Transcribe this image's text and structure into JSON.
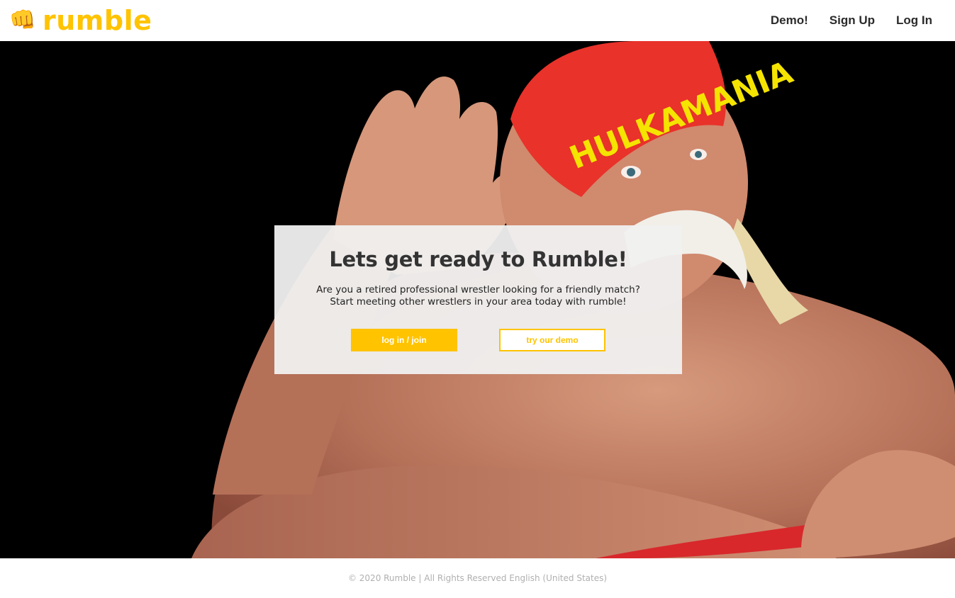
{
  "header": {
    "logo_icon": "fist-icon",
    "logo_glyph": "👊",
    "brand": "rumble",
    "nav": [
      {
        "label": "Demo!"
      },
      {
        "label": "Sign Up"
      },
      {
        "label": "Log In"
      }
    ]
  },
  "hero": {
    "title": "Lets get ready to Rumble!",
    "line1": "Are you a retired professional wrestler looking for a friendly match?",
    "line2": "Start meeting other wrestlers in your area today with rumble!",
    "primary_button": "log in / join",
    "secondary_button": "try our demo"
  },
  "footer": {
    "text": "© 2020 Rumble | All Rights Reserved English (United States)"
  },
  "colors": {
    "accent": "#ffc300",
    "nav_text": "#2b2b2b",
    "headband": "#e8322a",
    "headband_text": "#f4e400"
  }
}
